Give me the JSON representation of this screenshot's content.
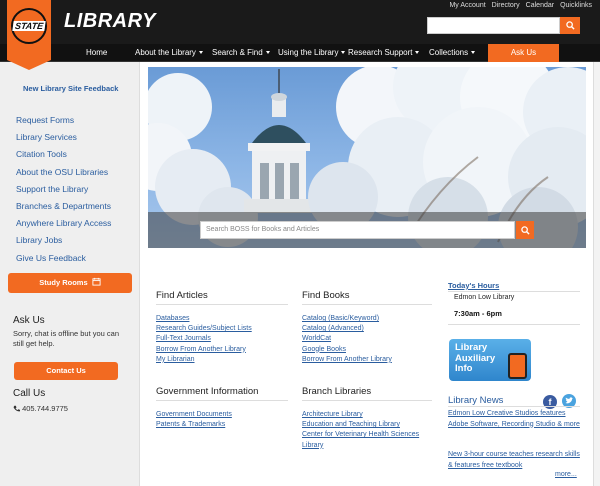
{
  "header": {
    "logo_text": "STATE",
    "site_title": "LIBRARY",
    "util_links": [
      "My Account",
      "Directory",
      "Calendar",
      "Quicklinks"
    ]
  },
  "nav": {
    "items": [
      {
        "label": "Home",
        "dropdown": false
      },
      {
        "label": "About the Library",
        "dropdown": true
      },
      {
        "label": "Search & Find",
        "dropdown": true
      },
      {
        "label": "Using the Library",
        "dropdown": true
      },
      {
        "label": "Research Support",
        "dropdown": true
      },
      {
        "label": "Collections",
        "dropdown": true
      }
    ],
    "ask": "Ask Us"
  },
  "sidebar": {
    "feedback": "New Library Site Feedback",
    "links": [
      "Request Forms",
      "Library Services",
      "Citation Tools",
      "About the OSU Libraries",
      "Support the Library",
      "Branches & Departments",
      "Anywhere Library Access",
      "Library Jobs",
      "Give Us Feedback"
    ],
    "study_rooms": "Study Rooms",
    "ask_us_title": "Ask Us",
    "chat_status": "Sorry, chat is offline but you can still get help.",
    "contact_button": "Contact Us",
    "call_us_title": "Call Us",
    "phone": "405.744.9775"
  },
  "hero": {
    "search_placeholder": "Search BOSS for Books and Articles"
  },
  "sections": {
    "find_articles": {
      "title": "Find Articles",
      "links": [
        "Databases",
        "Research Guides/Subject Lists",
        "Full-Text Journals",
        "Borrow From Another Library",
        "My Librarian"
      ]
    },
    "find_books": {
      "title": "Find Books",
      "links": [
        "Catalog (Basic/Keyword)",
        "Catalog (Advanced)",
        "WorldCat",
        "Google Books",
        "Borrow From Another Library"
      ]
    },
    "gov_info": {
      "title": "Government Information",
      "links": [
        "Government Documents",
        "Patents & Trademarks"
      ]
    },
    "branch_libraries": {
      "title": "Branch Libraries",
      "links": [
        "Architecture Library",
        "Education and Teaching Library",
        "Center for Veterinary Health Sciences Library"
      ]
    }
  },
  "right": {
    "hours_title": "Today's Hours",
    "hours_location": "Edmon Low Library",
    "hours_time": "7:30am - 6pm",
    "aux_text": "Library\nAuxiliary\nInfo",
    "news_title": "Library News",
    "news_items": [
      "Edmon Low Creative Studios features Adobe Software, Recording Studio & more",
      "New 3-hour course teaches research skills & features free textbook"
    ],
    "more": "more..."
  },
  "colors": {
    "accent": "#f26a21",
    "header_bg": "#1a1a1a",
    "link": "#2a5d9f",
    "sidebar_bg": "#efefef"
  }
}
